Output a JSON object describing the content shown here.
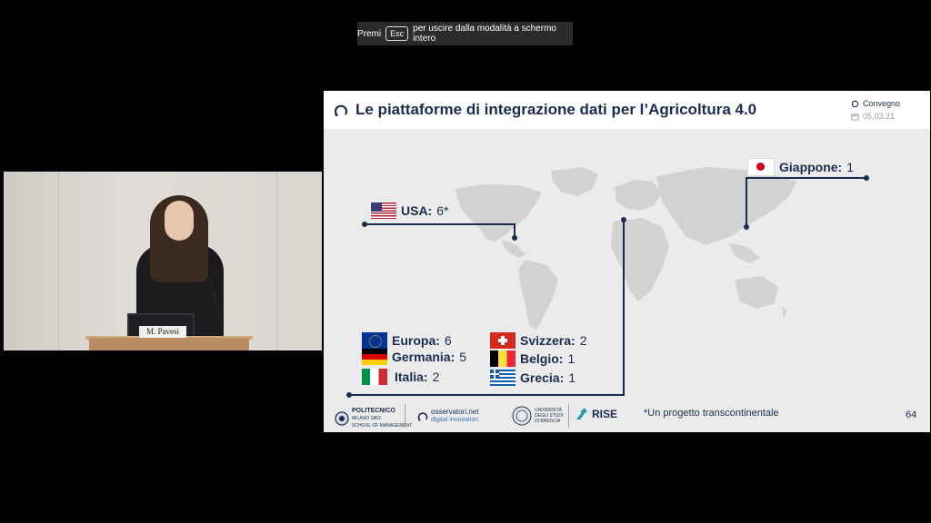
{
  "banner": {
    "prefix": "Premi",
    "key": "Esc",
    "suffix": "per uscire dalla modalità a schermo intero"
  },
  "video": {
    "nameplate": "M. Pavesi"
  },
  "slide": {
    "title": "Le piattaforme di integrazione dati per l’Agricoltura 4.0",
    "event": "Convegno",
    "date": "05.03.21",
    "page": "64",
    "footnote": "*Un progetto transcontinentale",
    "countries": {
      "usa": {
        "name": "USA:",
        "count": "6*"
      },
      "japan": {
        "name": "Giappone:",
        "count": "1"
      },
      "europe": {
        "name": "Europa:",
        "count": "6"
      },
      "germany": {
        "name": "Germania:",
        "count": "5"
      },
      "italy": {
        "name": "Italia:",
        "count": "2"
      },
      "switzerland": {
        "name": "Svizzera:",
        "count": "2"
      },
      "belgium": {
        "name": "Belgio:",
        "count": "1"
      },
      "greece": {
        "name": "Grecia:",
        "count": "1"
      }
    },
    "logos": {
      "polimi": {
        "name": "POLITECNICO",
        "sub1": "MILANO 1863",
        "sub2": "SCHOOL OF MANAGEMENT"
      },
      "osservatori": {
        "name": "osservatori.net",
        "sub": "digital innovation"
      },
      "unibs": {
        "l1": "UNIVERSITÀ",
        "l2": "DEGLI STUDI",
        "l3": "DI BRESCIA"
      },
      "rise": {
        "name": "RISE"
      }
    },
    "colors": {
      "navy": "#1a2d4e",
      "map": "#d2d2d2",
      "background": "#ebebeb"
    }
  }
}
